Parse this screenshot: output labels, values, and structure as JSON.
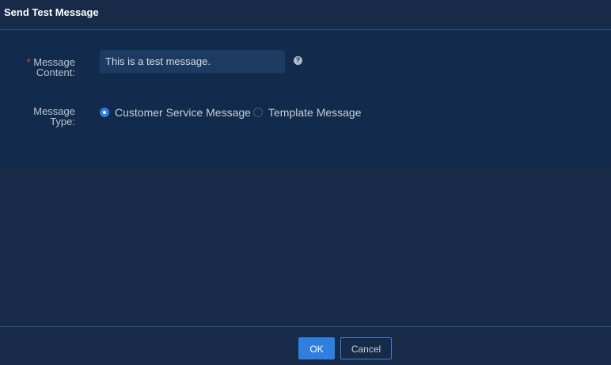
{
  "dialog": {
    "title": "Send Test Message"
  },
  "form": {
    "content": {
      "required_mark": "*",
      "label_line1": "Message",
      "label_line2": "Content:",
      "value": "This is a test message.",
      "help_icon": "question-circle-icon"
    },
    "type": {
      "label_line1": "Message",
      "label_line2": "Type:",
      "options": [
        {
          "label": "Customer Service Message",
          "selected": true
        },
        {
          "label": "Template Message",
          "selected": false
        }
      ]
    }
  },
  "footer": {
    "ok_label": "OK",
    "cancel_label": "Cancel"
  },
  "colors": {
    "background": "#172a48",
    "form_background": "#122a4b",
    "accent": "#2f7fe0",
    "required": "#e8484b",
    "divider": "#2c5685"
  }
}
